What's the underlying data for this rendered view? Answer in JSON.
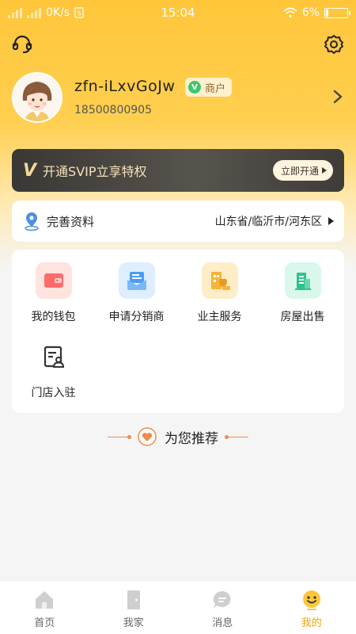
{
  "status": {
    "speed": "0K/s",
    "time": "15:04",
    "battery": "6%",
    "battery_level": 0.06
  },
  "header": {
    "support_icon": "headset-icon",
    "settings_icon": "gear-icon"
  },
  "profile": {
    "username": "zfn-iLxvGoJw",
    "badge": "商户",
    "badge_mark": "V",
    "phone": "18500800905"
  },
  "vip": {
    "mark": "V",
    "text": "开通SVIP立享特权",
    "button": "立即开通"
  },
  "complete_profile": {
    "title": "完善资料",
    "location": "山东省/临沂市/河东区"
  },
  "services": [
    {
      "label": "我的钱包",
      "icon": "wallet-icon",
      "color": "#ff6b6b",
      "bg": "#ffe3df"
    },
    {
      "label": "申请分销商",
      "icon": "distributor-icon",
      "color": "#4a9df5",
      "bg": "#deeeff"
    },
    {
      "label": "业主服务",
      "icon": "owner-service-icon",
      "color": "#f4b53c",
      "bg": "#ffedc8"
    },
    {
      "label": "房屋出售",
      "icon": "house-sale-icon",
      "color": "#2fc28e",
      "bg": "#d9f7ea"
    },
    {
      "label": "门店入驻",
      "icon": "store-join-icon",
      "color": "#333333",
      "bg": "#ffffff"
    }
  ],
  "recommend": {
    "title": "为您推荐"
  },
  "tabs": [
    {
      "label": "首页",
      "icon": "home-icon"
    },
    {
      "label": "我家",
      "icon": "door-icon"
    },
    {
      "label": "消息",
      "icon": "message-icon"
    },
    {
      "label": "我的",
      "icon": "profile-icon",
      "active": true
    }
  ],
  "colors": {
    "accent": "#ffc63a",
    "active_tab": "#f0a400",
    "vip_bg": "#4a4743"
  }
}
